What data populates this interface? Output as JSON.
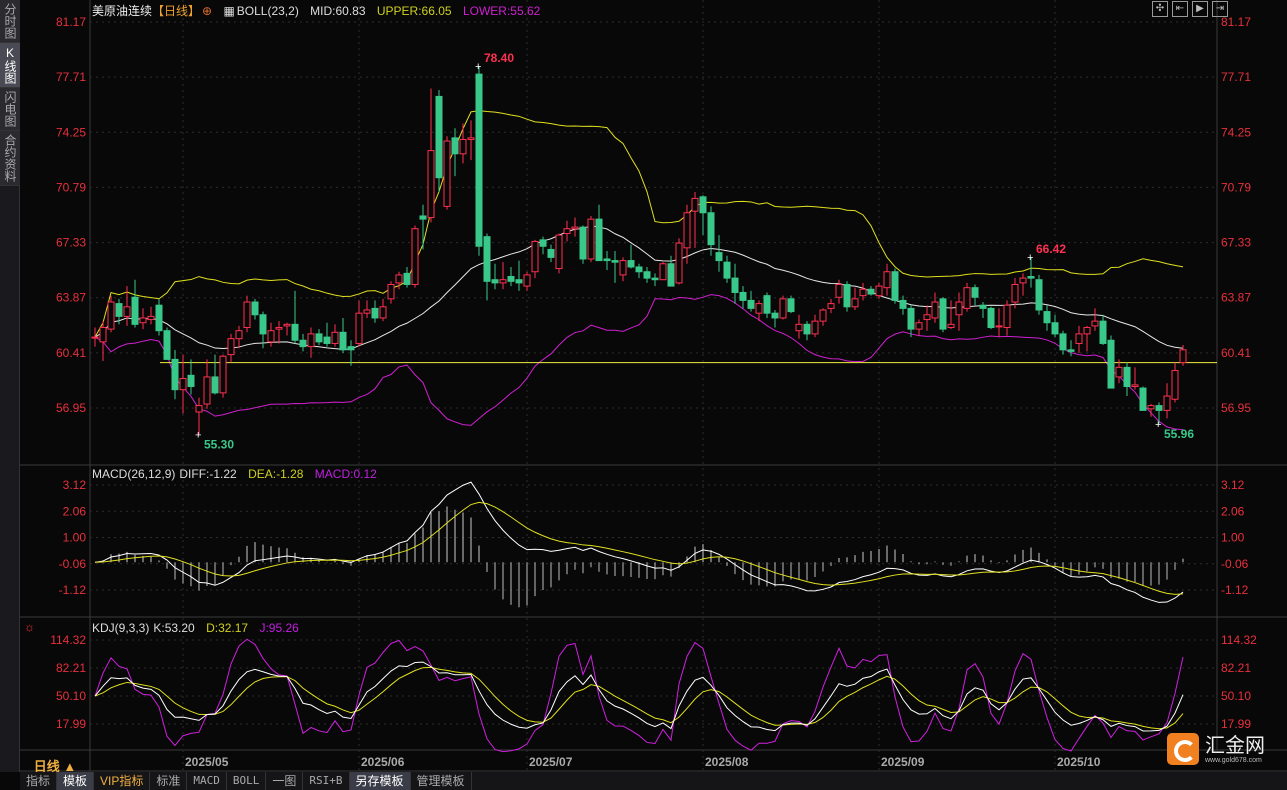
{
  "sidebar": {
    "items": [
      {
        "label": "分时图",
        "active": false
      },
      {
        "label": "K线图",
        "active": true
      },
      {
        "label": "闪电图",
        "active": false
      },
      {
        "label": "合约资料",
        "active": false
      }
    ]
  },
  "header": {
    "title": "美原油连续",
    "period_tag": "【日线】",
    "indicator": "BOLL(23,2)",
    "mid": "MID:60.83",
    "upper": "UPPER:66.05",
    "lower": "LOWER:55.62"
  },
  "tools": [
    {
      "icon": "crosshair-icon",
      "glyph": "✣"
    },
    {
      "icon": "fit-left-icon",
      "glyph": "⇤"
    },
    {
      "icon": "play-right-icon",
      "glyph": "▶"
    },
    {
      "icon": "scroll-end-icon",
      "glyph": "⇥"
    }
  ],
  "macd_header": {
    "name": "MACD(26,12,9)",
    "diff": "DIFF:-1.22",
    "dea": "DEA:-1.28",
    "macd": "MACD:0.12"
  },
  "kdj_header": {
    "name": "KDJ(9,3,3)",
    "k": "K:53.20",
    "d": "D:32.17",
    "j": "J:95.26"
  },
  "colors": {
    "up": "#ff3050",
    "down": "#38c98a",
    "mid": "#e8e8e8",
    "upper": "#e0e020",
    "lower": "#d020d0",
    "axis": "#e8303c",
    "ref_line": "#f0f040"
  },
  "chart_data": [
    {
      "type": "candlestick",
      "name": "main",
      "ylim": [
        55.0,
        81.6
      ],
      "yticks": [
        "81.17",
        "77.71",
        "74.25",
        "70.79",
        "67.33",
        "63.87",
        "60.41",
        "56.95"
      ],
      "reference_line": 59.8,
      "annotations": [
        {
          "label": "78.40",
          "index": 48,
          "value": 78.4,
          "kind": "high"
        },
        {
          "label": "55.30",
          "index": 13,
          "value": 55.3,
          "kind": "low"
        },
        {
          "label": "66.42",
          "index": 117,
          "value": 66.42,
          "kind": "high"
        },
        {
          "label": "55.96",
          "index": 133,
          "value": 55.96,
          "kind": "low"
        }
      ],
      "x_labels": [
        {
          "label": "2025/05",
          "index": 11
        },
        {
          "label": "2025/06",
          "index": 33
        },
        {
          "label": "2025/07",
          "index": 54
        },
        {
          "label": "2025/08",
          "index": 76
        },
        {
          "label": "2025/09",
          "index": 98
        },
        {
          "label": "2025/10",
          "index": 120
        }
      ],
      "ohlc": [
        [
          61.4,
          62.0,
          60.8,
          61.4
        ],
        [
          61.1,
          62.4,
          59.9,
          62.0
        ],
        [
          61.9,
          64.0,
          61.7,
          63.6
        ],
        [
          63.5,
          63.8,
          62.2,
          62.7
        ],
        [
          62.7,
          64.6,
          62.1,
          63.3
        ],
        [
          63.9,
          65.0,
          62.0,
          62.2
        ],
        [
          62.3,
          63.2,
          61.9,
          62.6
        ],
        [
          62.5,
          63.3,
          62.2,
          62.7
        ],
        [
          63.4,
          63.8,
          61.5,
          61.8
        ],
        [
          61.8,
          62.0,
          60.0,
          60.0
        ],
        [
          60.0,
          60.6,
          57.5,
          58.1
        ],
        [
          58.1,
          60.3,
          56.6,
          58.8
        ],
        [
          59.0,
          60.0,
          57.8,
          58.3
        ],
        [
          56.7,
          57.6,
          55.3,
          57.1
        ],
        [
          57.2,
          60.0,
          56.9,
          58.9
        ],
        [
          58.9,
          60.3,
          57.8,
          57.9
        ],
        [
          57.9,
          60.3,
          57.6,
          60.2
        ],
        [
          60.3,
          61.6,
          59.8,
          61.3
        ],
        [
          61.3,
          62.1,
          60.7,
          61.8
        ],
        [
          62.0,
          64.0,
          61.7,
          63.6
        ],
        [
          63.6,
          63.8,
          62.5,
          62.8
        ],
        [
          62.8,
          63.0,
          60.7,
          61.6
        ],
        [
          61.1,
          62.3,
          60.8,
          61.8
        ],
        [
          61.9,
          62.4,
          61.0,
          62.0
        ],
        [
          62.1,
          62.3,
          61.5,
          62.2
        ],
        [
          62.2,
          64.3,
          61.0,
          61.2
        ],
        [
          61.2,
          61.6,
          60.5,
          60.8
        ],
        [
          60.8,
          62.0,
          60.1,
          61.6
        ],
        [
          61.6,
          61.9,
          60.9,
          61.1
        ],
        [
          61.4,
          62.3,
          60.8,
          61.0
        ],
        [
          61.0,
          62.2,
          60.8,
          61.7
        ],
        [
          61.7,
          62.6,
          60.4,
          60.6
        ],
        [
          60.8,
          61.2,
          59.6,
          60.6
        ],
        [
          61.0,
          63.7,
          60.8,
          62.9
        ],
        [
          62.9,
          63.7,
          62.6,
          63.1
        ],
        [
          63.2,
          63.7,
          62.3,
          62.6
        ],
        [
          62.6,
          63.8,
          62.4,
          63.3
        ],
        [
          63.8,
          64.9,
          63.5,
          64.7
        ],
        [
          64.8,
          65.5,
          64.4,
          65.3
        ],
        [
          65.4,
          65.8,
          64.5,
          64.7
        ],
        [
          64.7,
          68.4,
          64.5,
          68.2
        ],
        [
          69.0,
          69.7,
          66.9,
          68.8
        ],
        [
          68.9,
          77.0,
          68.6,
          73.1
        ],
        [
          76.5,
          76.9,
          70.5,
          71.4
        ],
        [
          69.6,
          74.0,
          69.4,
          73.7
        ],
        [
          73.9,
          74.5,
          71.5,
          72.9
        ],
        [
          72.9,
          74.8,
          72.3,
          73.8
        ],
        [
          73.8,
          75.0,
          72.5,
          73.9
        ],
        [
          77.9,
          78.4,
          66.5,
          67.1
        ],
        [
          67.7,
          67.9,
          63.7,
          64.9
        ],
        [
          65.0,
          66.0,
          64.4,
          64.8
        ],
        [
          64.8,
          66.1,
          64.4,
          65.0
        ],
        [
          65.2,
          65.8,
          64.6,
          64.9
        ],
        [
          65.0,
          66.2,
          64.3,
          64.8
        ],
        [
          64.6,
          65.5,
          64.3,
          65.3
        ],
        [
          65.5,
          67.5,
          65.1,
          67.4
        ],
        [
          67.5,
          67.7,
          66.6,
          67.1
        ],
        [
          66.9,
          67.2,
          66.1,
          66.4
        ],
        [
          65.7,
          67.9,
          65.4,
          67.8
        ],
        [
          67.9,
          68.7,
          67.4,
          68.2
        ],
        [
          68.2,
          68.9,
          67.7,
          68.3
        ],
        [
          68.3,
          68.4,
          66.0,
          66.3
        ],
        [
          66.3,
          69.0,
          66.1,
          68.8
        ],
        [
          68.8,
          69.7,
          66.2,
          66.2
        ],
        [
          66.3,
          66.8,
          65.6,
          66.2
        ],
        [
          66.2,
          66.8,
          64.8,
          66.1
        ],
        [
          65.3,
          66.4,
          64.9,
          66.2
        ],
        [
          66.2,
          67.2,
          65.7,
          65.8
        ],
        [
          65.8,
          66.0,
          65.1,
          65.5
        ],
        [
          65.5,
          65.8,
          64.8,
          65.1
        ],
        [
          65.1,
          65.4,
          64.6,
          65.0
        ],
        [
          65.0,
          66.1,
          65.0,
          66.0
        ],
        [
          66.0,
          66.5,
          64.6,
          64.6
        ],
        [
          64.8,
          67.6,
          64.7,
          67.3
        ],
        [
          67.0,
          69.7,
          66.0,
          69.2
        ],
        [
          69.3,
          70.5,
          67.0,
          70.1
        ],
        [
          70.2,
          70.3,
          67.8,
          69.2
        ],
        [
          69.2,
          69.6,
          66.5,
          67.2
        ],
        [
          66.7,
          67.8,
          65.5,
          66.2
        ],
        [
          66.1,
          66.5,
          64.8,
          65.1
        ],
        [
          65.1,
          66.0,
          63.5,
          64.2
        ],
        [
          64.2,
          64.6,
          63.2,
          63.7
        ],
        [
          63.7,
          64.3,
          63.0,
          63.2
        ],
        [
          62.9,
          63.7,
          62.4,
          63.5
        ],
        [
          64.0,
          64.2,
          62.6,
          62.9
        ],
        [
          62.9,
          63.1,
          62.0,
          62.6
        ],
        [
          62.6,
          64.0,
          62.5,
          63.8
        ],
        [
          63.8,
          64.0,
          62.9,
          63.0
        ],
        [
          61.8,
          62.8,
          61.3,
          62.2
        ],
        [
          62.2,
          62.4,
          61.2,
          61.6
        ],
        [
          61.6,
          62.8,
          61.4,
          62.4
        ],
        [
          62.4,
          63.2,
          62.1,
          63.1
        ],
        [
          63.2,
          63.8,
          62.9,
          63.5
        ],
        [
          63.9,
          65.0,
          63.5,
          64.7
        ],
        [
          64.7,
          64.9,
          63.0,
          63.3
        ],
        [
          63.3,
          64.5,
          63.1,
          63.8
        ],
        [
          64.0,
          64.8,
          63.7,
          64.4
        ],
        [
          64.4,
          64.6,
          64.0,
          64.1
        ],
        [
          64.0,
          64.8,
          63.8,
          64.6
        ],
        [
          64.5,
          66.0,
          64.0,
          65.5
        ],
        [
          65.5,
          65.7,
          63.5,
          63.7
        ],
        [
          63.7,
          64.0,
          62.8,
          63.2
        ],
        [
          63.2,
          63.4,
          61.4,
          61.9
        ],
        [
          61.9,
          62.5,
          61.5,
          62.3
        ],
        [
          62.5,
          63.4,
          61.8,
          62.8
        ],
        [
          62.6,
          64.2,
          62.3,
          63.6
        ],
        [
          63.8,
          63.9,
          61.7,
          61.9
        ],
        [
          62.0,
          63.7,
          61.9,
          62.2
        ],
        [
          62.8,
          64.2,
          61.8,
          63.6
        ],
        [
          63.2,
          64.8,
          63.0,
          64.5
        ],
        [
          64.5,
          64.7,
          63.4,
          63.9
        ],
        [
          63.4,
          63.6,
          62.6,
          63.2
        ],
        [
          63.2,
          63.3,
          61.9,
          62.0
        ],
        [
          62.1,
          63.2,
          61.4,
          62.1
        ],
        [
          62.0,
          63.7,
          61.5,
          63.4
        ],
        [
          63.6,
          65.1,
          63.2,
          64.7
        ],
        [
          64.8,
          65.4,
          64.0,
          65.1
        ],
        [
          65.2,
          66.42,
          64.5,
          65.1
        ],
        [
          65.0,
          65.3,
          62.8,
          63.1
        ],
        [
          63.0,
          63.4,
          61.8,
          62.3
        ],
        [
          62.3,
          62.8,
          61.4,
          61.6
        ],
        [
          61.6,
          61.8,
          60.3,
          60.6
        ],
        [
          60.6,
          61.2,
          60.2,
          60.5
        ],
        [
          61.0,
          62.1,
          60.4,
          61.6
        ],
        [
          61.6,
          62.1,
          60.5,
          62.0
        ],
        [
          62.1,
          63.2,
          61.8,
          62.4
        ],
        [
          62.4,
          62.8,
          60.9,
          61.0
        ],
        [
          61.2,
          61.5,
          58.2,
          58.2
        ],
        [
          58.9,
          60.0,
          58.5,
          59.5
        ],
        [
          59.5,
          59.8,
          57.7,
          58.3
        ],
        [
          58.3,
          59.5,
          58.1,
          58.4
        ],
        [
          58.2,
          58.3,
          56.8,
          56.8
        ],
        [
          56.9,
          57.2,
          56.4,
          57.1
        ],
        [
          57.1,
          57.3,
          55.96,
          56.8
        ],
        [
          56.8,
          58.5,
          56.3,
          57.7
        ],
        [
          57.5,
          59.8,
          57.3,
          59.3
        ],
        [
          59.8,
          60.9,
          59.6,
          60.6
        ]
      ]
    },
    {
      "type": "macd",
      "name": "MACD(26,12,9)",
      "yticks": [
        "3.12",
        "2.06",
        "1.00",
        "-0.06",
        "-1.12"
      ]
    },
    {
      "type": "kdj",
      "name": "KDJ(9,3,3)",
      "yticks": [
        "114.32",
        "82.21",
        "50.10",
        "17.99"
      ]
    }
  ],
  "period_label": "日线 ▲",
  "toolbar": [
    {
      "label": "指标",
      "sel": false
    },
    {
      "label": "模板",
      "sel": true
    },
    {
      "label": "VIP指标",
      "vip": true
    },
    {
      "label": "标准"
    },
    {
      "label": "MACD",
      "mono": true
    },
    {
      "label": "BOLL",
      "mono": true
    },
    {
      "label": "一图"
    },
    {
      "label": "RSI+B",
      "mono": true
    },
    {
      "label": "另存模板",
      "sel": true
    },
    {
      "label": "管理模板"
    }
  ],
  "logo": {
    "name": "汇金网",
    "url": "www.gold678.com"
  }
}
